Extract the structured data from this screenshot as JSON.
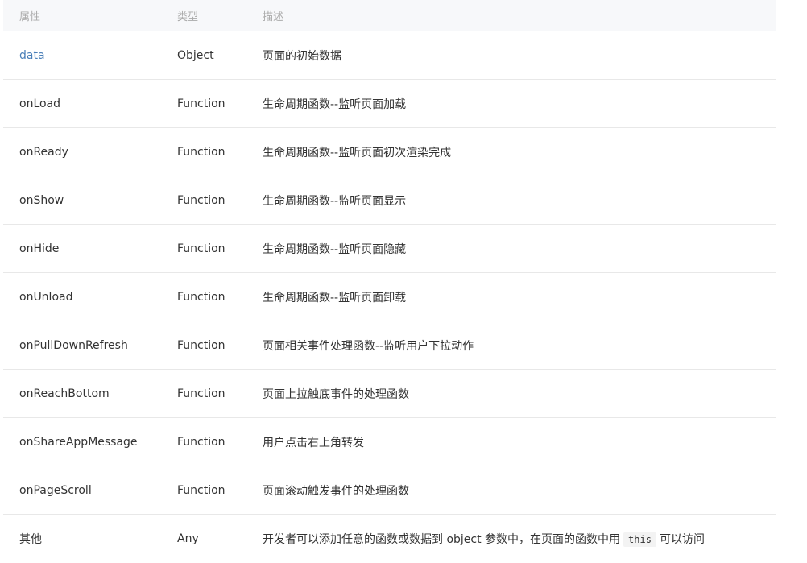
{
  "headers": {
    "prop": "属性",
    "type": "类型",
    "desc": "描述"
  },
  "rows": [
    {
      "prop": "data",
      "type": "Object",
      "desc": "页面的初始数据"
    },
    {
      "prop": "onLoad",
      "type": "Function",
      "desc": "生命周期函数--监听页面加载"
    },
    {
      "prop": "onReady",
      "type": "Function",
      "desc": "生命周期函数--监听页面初次渲染完成"
    },
    {
      "prop": "onShow",
      "type": "Function",
      "desc": "生命周期函数--监听页面显示"
    },
    {
      "prop": "onHide",
      "type": "Function",
      "desc": "生命周期函数--监听页面隐藏"
    },
    {
      "prop": "onUnload",
      "type": "Function",
      "desc": "生命周期函数--监听页面卸载"
    },
    {
      "prop": "onPullDownRefresh",
      "type": "Function",
      "desc": "页面相关事件处理函数--监听用户下拉动作"
    },
    {
      "prop": "onReachBottom",
      "type": "Function",
      "desc": "页面上拉触底事件的处理函数"
    },
    {
      "prop": "onShareAppMessage",
      "type": "Function",
      "desc": "用户点击右上角转发"
    },
    {
      "prop": "onPageScroll",
      "type": "Function",
      "desc": "页面滚动触发事件的处理函数"
    },
    {
      "prop": "其他",
      "type": "Any",
      "desc_before": "开发者可以添加任意的函数或数据到 object 参数中，在页面的函数中用",
      "desc_code": "this",
      "desc_after": "可以访问"
    }
  ],
  "colors": {
    "link": "#4a7fb8",
    "header_bg": "#f7f8fa",
    "header_text": "#aaaaaa",
    "border": "#e8e8e8"
  }
}
